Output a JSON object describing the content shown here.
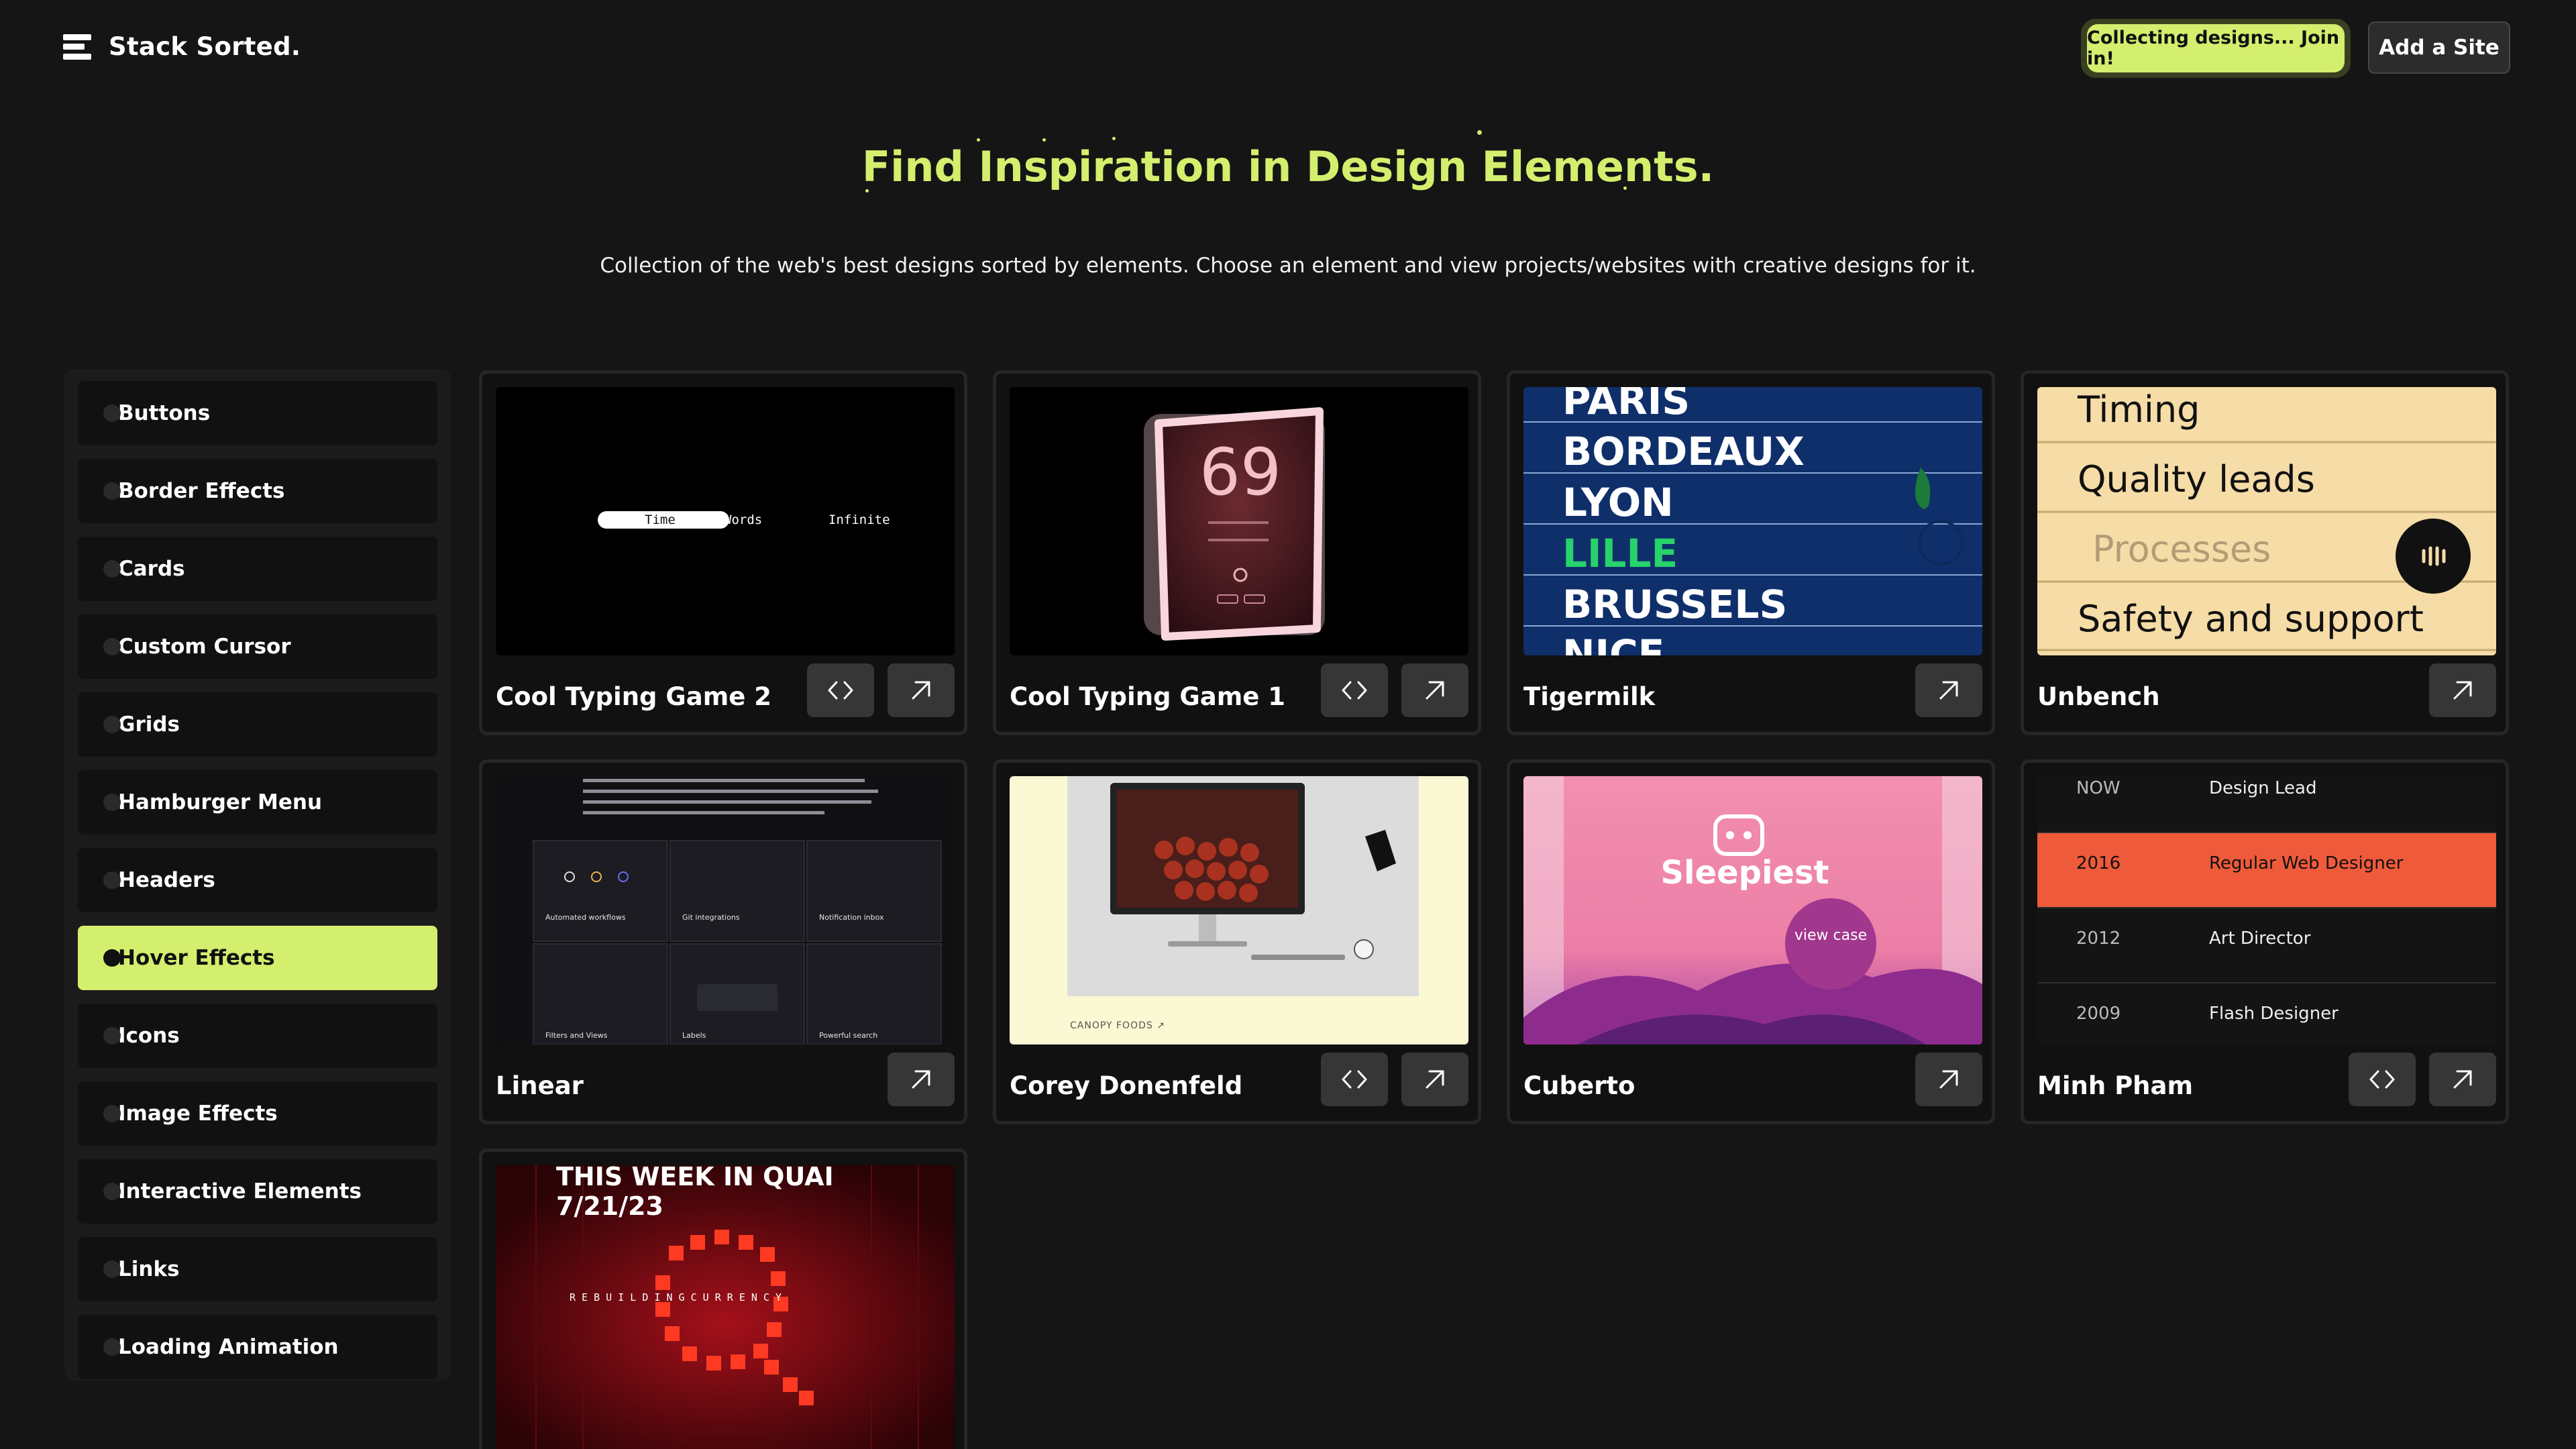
{
  "header": {
    "logo_text": "Stack Sorted.",
    "collect_label": "Collecting designs... Join in!",
    "add_label": "Add a Site"
  },
  "hero": {
    "title": "Find Inspiration in Design Elements.",
    "subtitle": "Collection of the web's best designs sorted by elements. Choose an element and view projects/websites with creative designs for it."
  },
  "sidebar": {
    "items": [
      {
        "label": "Buttons"
      },
      {
        "label": "Border Effects"
      },
      {
        "label": "Cards"
      },
      {
        "label": "Custom Cursor"
      },
      {
        "label": "Grids"
      },
      {
        "label": "Hamburger Menu"
      },
      {
        "label": "Headers"
      },
      {
        "label": "Hover Effects",
        "active": true
      },
      {
        "label": "Icons"
      },
      {
        "label": "Image Effects"
      },
      {
        "label": "Interactive Elements"
      },
      {
        "label": "Links"
      },
      {
        "label": "Loading Animation"
      }
    ]
  },
  "cards": [
    {
      "title": "Cool Typing Game 2",
      "has_code": true,
      "preview": {
        "word1": "Time",
        "word2": "Words",
        "word3": "Infinite"
      }
    },
    {
      "title": "Cool Typing Game 1",
      "has_code": true,
      "preview": {
        "score": "69"
      }
    },
    {
      "title": "Tigermilk",
      "has_code": false,
      "preview": {
        "cities": [
          "PARIS",
          "BORDEAUX",
          "LYON",
          "LILLE",
          "BRUSSELS",
          "NICE"
        ]
      }
    },
    {
      "title": "Unbench",
      "has_code": false,
      "preview": {
        "rows": [
          "Timing",
          "Quality leads",
          "Processes",
          "Safety and support"
        ]
      }
    },
    {
      "title": "Linear",
      "has_code": false,
      "preview": {
        "labels": [
          "Automated workflows",
          "Git integrations",
          "Notification inbox",
          "Filters and Views",
          "Labels",
          "Powerful search"
        ]
      }
    },
    {
      "title": "Corey Donenfeld",
      "has_code": true,
      "preview": {
        "caption": "CANOPY FOODS ↗"
      }
    },
    {
      "title": "Cuberto",
      "has_code": false,
      "preview": {
        "brand": "Sleepiest",
        "badge": "view case"
      }
    },
    {
      "title": "Minh Pham",
      "has_code": true,
      "preview": {
        "rows": [
          {
            "year": "NOW",
            "role": "Design Lead"
          },
          {
            "year": "2016",
            "role": "Regular Web Designer"
          },
          {
            "year": "2012",
            "role": "Art Director"
          },
          {
            "year": "2009",
            "role": "Flash Designer"
          }
        ]
      }
    },
    {
      "title": "",
      "has_code": false,
      "preview": {
        "headline": "THIS WEEK IN QUAI",
        "date": "7/21/23",
        "tagline": "R E B U I L D I N G   C U R R E N C Y"
      }
    }
  ],
  "colors": {
    "accent": "#d4ee6d",
    "background": "#151515",
    "card_bg": "#111111",
    "button_bg": "#363636"
  },
  "icons": {
    "code": "code-brackets-icon",
    "external": "arrow-up-right-icon",
    "logo": "stack-bars-icon"
  }
}
